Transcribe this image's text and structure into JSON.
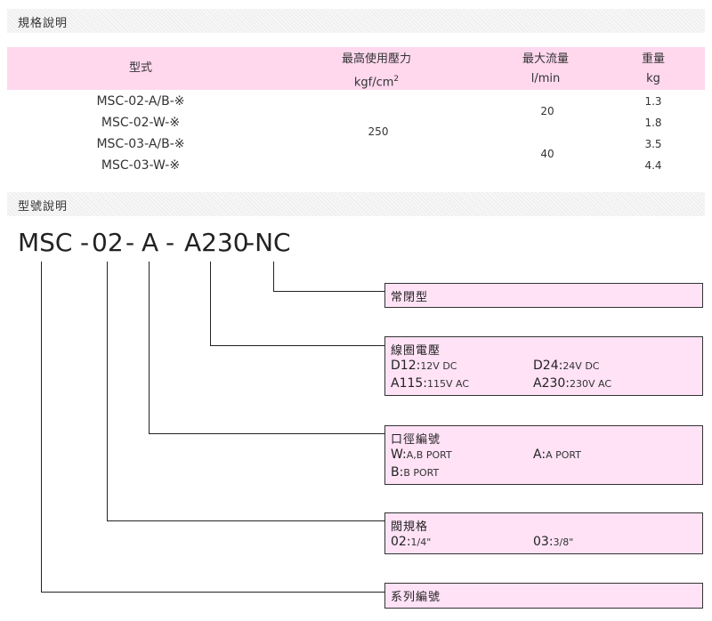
{
  "sections": {
    "spec_title": "規格說明",
    "model_title": "型號說明"
  },
  "spec_table": {
    "headers": {
      "model": "型式",
      "pressure": "最高使用壓力",
      "pressure_unit": "kgf/cm",
      "pressure_unit_sup": "2",
      "flow": "最大流量",
      "flow_unit": "l/min",
      "weight": "重量",
      "weight_unit": "kg"
    },
    "models": [
      "MSC-02-A/B-※",
      "MSC-02-W-※",
      "MSC-03-A/B-※",
      "MSC-03-W-※"
    ],
    "pressure": "250",
    "flows": [
      "20",
      "40"
    ],
    "weights": [
      "1.3",
      "1.8",
      "3.5",
      "4.4"
    ]
  },
  "model_code": {
    "parts": [
      "MSC",
      "-",
      "02",
      "-",
      "A",
      "-",
      "A230",
      "-NC"
    ]
  },
  "boxes": {
    "nc": {
      "title": "常閉型"
    },
    "coil": {
      "title": "線圈電壓",
      "options": [
        {
          "key": "D12:",
          "val": "12V DC"
        },
        {
          "key": "D24:",
          "val": "24V DC"
        },
        {
          "key": "A115:",
          "val": "115V AC"
        },
        {
          "key": "A230:",
          "val": "230V AC"
        }
      ]
    },
    "port": {
      "title": "口徑編號",
      "options": [
        {
          "key": "W:",
          "val": "A,B PORT"
        },
        {
          "key": "A:",
          "val": "A PORT"
        },
        {
          "key": "B:",
          "val": "B PORT"
        }
      ]
    },
    "valve": {
      "title": "閥規格",
      "options": [
        {
          "key": "02:",
          "val": "1/4\""
        },
        {
          "key": "03:",
          "val": "3/8\""
        }
      ]
    },
    "series": {
      "title": "系列編號"
    }
  }
}
